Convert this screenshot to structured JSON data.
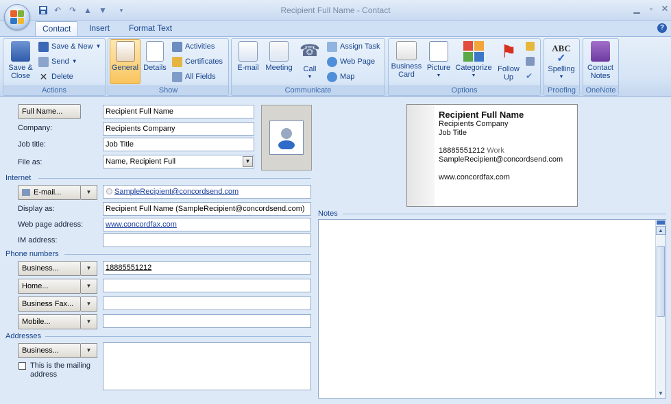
{
  "window": {
    "title": "Recipient Full Name - Contact"
  },
  "tabs": [
    {
      "label": "Contact",
      "active": true
    },
    {
      "label": "Insert",
      "active": false
    },
    {
      "label": "Format Text",
      "active": false
    }
  ],
  "ribbon": {
    "actions": {
      "label": "Actions",
      "save_close": "Save &\nClose",
      "save_new": "Save & New",
      "send": "Send",
      "delete": "Delete"
    },
    "show": {
      "label": "Show",
      "general": "General",
      "details": "Details",
      "activities": "Activities",
      "certificates": "Certificates",
      "all_fields": "All Fields"
    },
    "communicate": {
      "label": "Communicate",
      "email": "E-mail",
      "meeting": "Meeting",
      "call": "Call",
      "assign_task": "Assign Task",
      "web_page": "Web Page",
      "map": "Map"
    },
    "options": {
      "label": "Options",
      "business_card": "Business\nCard",
      "picture": "Picture",
      "categorize": "Categorize",
      "follow_up": "Follow\nUp"
    },
    "proofing": {
      "label": "Proofing",
      "spelling": "Spelling"
    },
    "onenote": {
      "label": "OneNote",
      "contact_notes": "Contact\nNotes"
    }
  },
  "form": {
    "full_name_button": "Full Name...",
    "full_name_value": "Recipient Full Name",
    "company_label": "Company:",
    "company_value": "Recipients Company",
    "job_title_label": "Job title:",
    "job_title_value": "Job Title",
    "file_as_label": "File as:",
    "file_as_value": "Name, Recipient Full",
    "internet_section": "Internet",
    "email_button": "E-mail...",
    "email_value": "SampleRecipient@concordsend.com",
    "display_as_label": "Display as:",
    "display_as_value": "Recipient Full Name (SampleRecipient@concordsend.com)",
    "web_page_label": "Web page address:",
    "web_page_value": "www.concordfax.com",
    "im_label": "IM address:",
    "im_value": "",
    "phone_section": "Phone numbers",
    "business_phone_button": "Business...",
    "business_phone_value": "18885551212",
    "home_button": "Home...",
    "home_value": "",
    "business_fax_button": "Business Fax...",
    "business_fax_value": "",
    "mobile_button": "Mobile...",
    "mobile_value": "",
    "addresses_section": "Addresses",
    "address_button": "Business...",
    "address_value": "",
    "mailing_address_checkbox": "This is the mailing\naddress",
    "notes_section": "Notes"
  },
  "business_card": {
    "name": "Recipient Full Name",
    "company": "Recipients Company",
    "job_title": "Job Title",
    "phone": "18885551212",
    "phone_type": "Work",
    "email": "SampleRecipient@concordsend.com",
    "web": "www.concordfax.com"
  },
  "colors": {
    "accent": "#15428b",
    "ribbon_bg": "#d5e4f5",
    "form_bg": "#dde9f7"
  }
}
